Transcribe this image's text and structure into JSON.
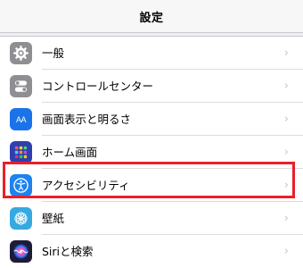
{
  "header": {
    "title": "設定"
  },
  "rows": [
    {
      "label": "一般",
      "icon": "gear-icon",
      "color": "#8e8e93"
    },
    {
      "label": "コントロールセンター",
      "icon": "toggles-icon",
      "color": "#8e8e93"
    },
    {
      "label": "画面表示と明るさ",
      "icon": "text-size-icon",
      "color": "#1a73e8",
      "icon_text": "AA"
    },
    {
      "label": "ホーム画面",
      "icon": "home-grid-icon",
      "color": "#2e3fb0"
    },
    {
      "label": "アクセシビリティ",
      "icon": "accessibility-icon",
      "color": "#1e82f0"
    },
    {
      "label": "壁紙",
      "icon": "wallpaper-flower-icon",
      "color": "#36a9e1"
    },
    {
      "label": "Siriと検索",
      "icon": "siri-icon",
      "color": "#1c1c3a"
    }
  ],
  "chevron": "›",
  "highlight_color": "#e8202a"
}
